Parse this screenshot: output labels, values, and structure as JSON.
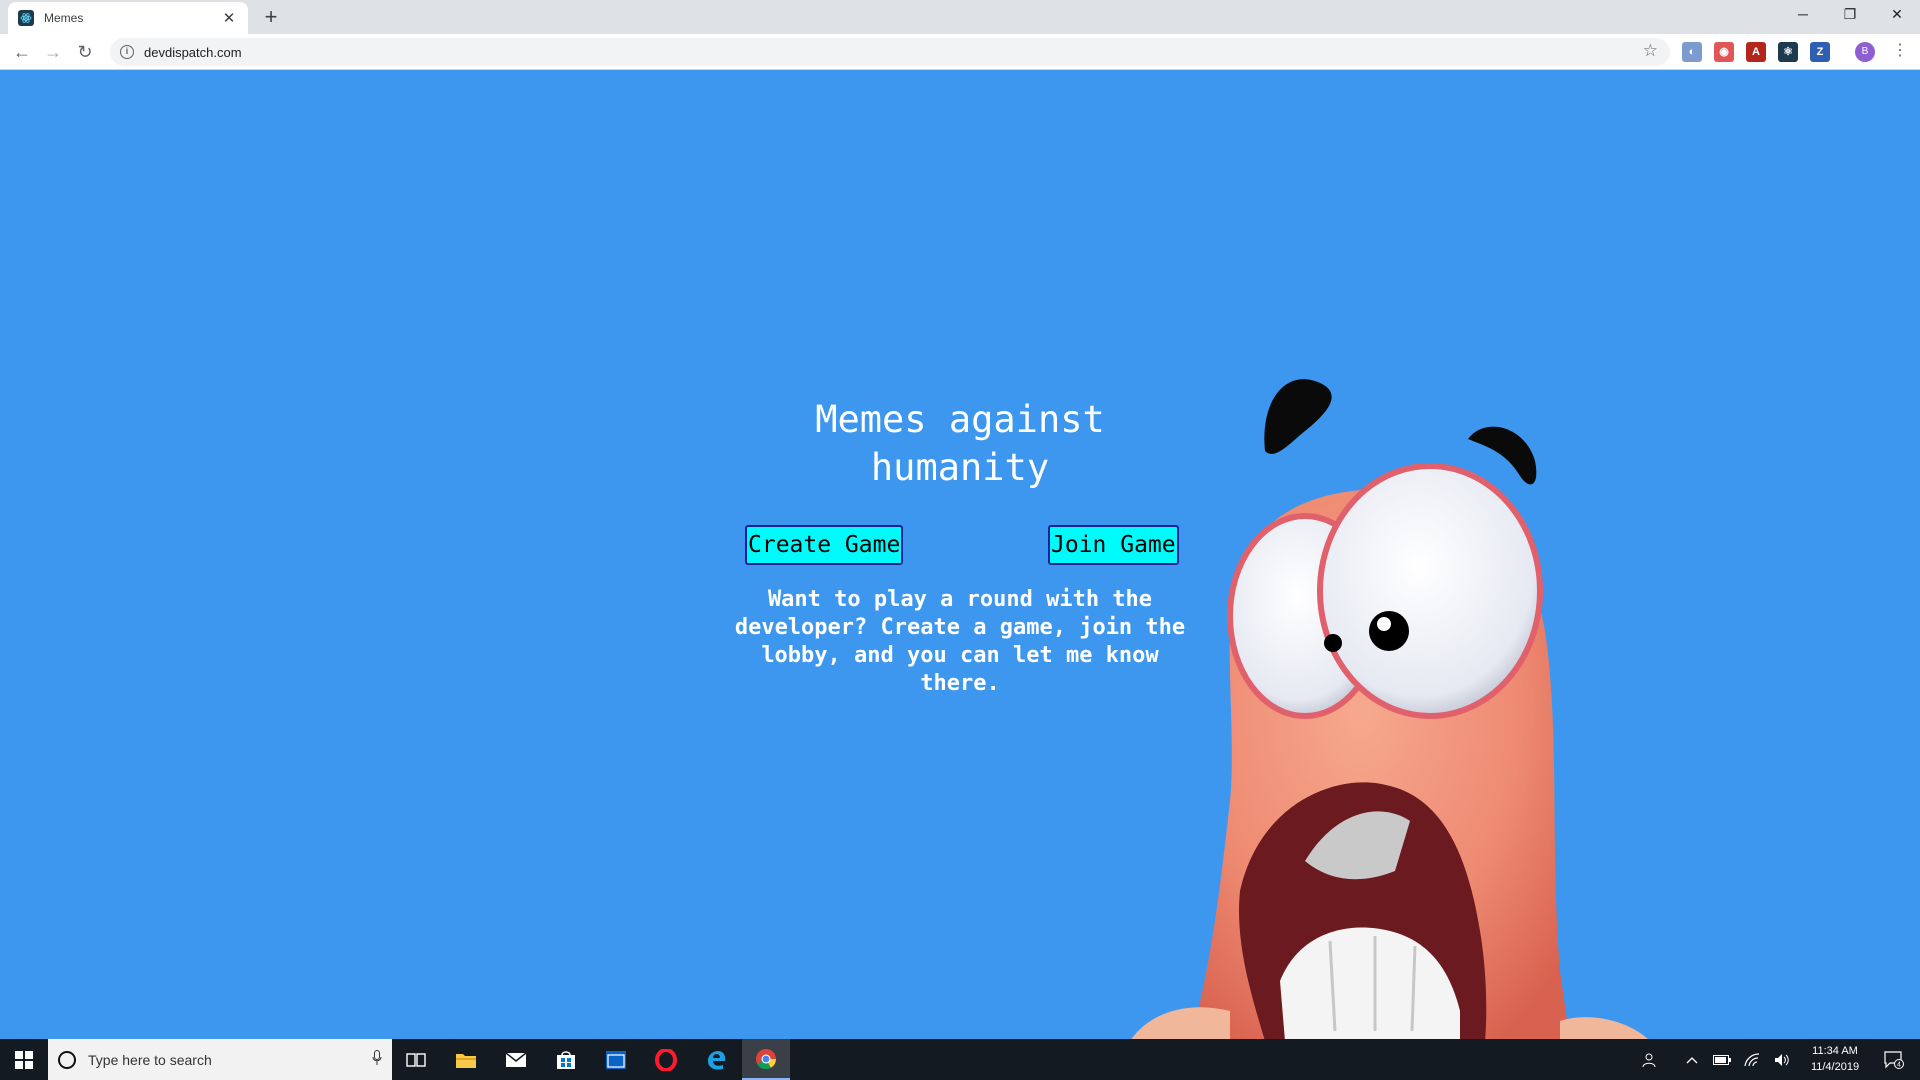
{
  "browser": {
    "tab_title": "Memes",
    "tab_close": "✕",
    "new_tab": "+",
    "url": "devdispatch.com",
    "window_controls": {
      "minimize": "─",
      "restore": "❐",
      "close": "✕"
    },
    "nav": {
      "back": "←",
      "forward": "→",
      "reload": "↻"
    },
    "bookmark_star": "☆",
    "extensions": [
      {
        "label": "◐",
        "color": "#7a9ccf"
      },
      {
        "label": "◉",
        "color": "#e05555"
      },
      {
        "label": "A",
        "color": "#b3261e"
      },
      {
        "label": "⚛",
        "color": "#1d3b4f"
      },
      {
        "label": "Z",
        "color": "#2f5fb3"
      }
    ],
    "profile_initial": "B",
    "menu": "⋮"
  },
  "page": {
    "title": "Memes against humanity",
    "create_button": "Create Game",
    "join_button": "Join Game",
    "description": "Want to play a round with the developer? Create a game, join the lobby, and you can let me know there.",
    "background_color": "#3d97ee",
    "button_color": "#00fbfb"
  },
  "taskbar": {
    "search_placeholder": "Type here to search",
    "time": "11:34 AM",
    "date": "11/4/2019",
    "notification_count": "4",
    "apps": [
      "windows-start-icon",
      "task-view-icon",
      "file-explorer-icon",
      "mail-icon",
      "store-icon",
      "app-window-icon",
      "opera-icon",
      "edge-icon",
      "chrome-icon"
    ]
  }
}
